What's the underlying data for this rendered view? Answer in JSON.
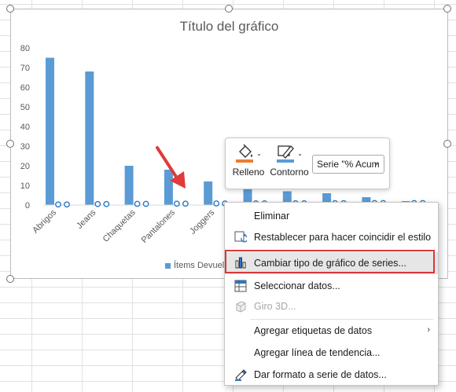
{
  "chart": {
    "title": "Título del gráfico",
    "legend_label": "Ítems Devuelto",
    "y_ticks": [
      "80",
      "70",
      "60",
      "50",
      "40",
      "30",
      "20",
      "10",
      "0"
    ]
  },
  "chart_data": {
    "type": "bar",
    "title": "Título del gráfico",
    "categories": [
      "Abrigos",
      "Jeans",
      "Chaquetas",
      "Pantalones",
      "Joggers",
      "",
      "",
      "",
      "",
      ""
    ],
    "series": [
      {
        "name": "Ítems Devuelto",
        "values": [
          75,
          68,
          20,
          18,
          12,
          8,
          7,
          6,
          4,
          2
        ]
      },
      {
        "name": "% Acum",
        "values": [
          0.3,
          0.5,
          0.6,
          0.7,
          0.8,
          0.85,
          0.9,
          0.95,
          0.98,
          1.0
        ]
      }
    ],
    "ylim": [
      0,
      80
    ],
    "colors": {
      "bar": "#5b9bd5",
      "accent": "#d9383a"
    }
  },
  "minibar": {
    "fill_label": "Relleno",
    "outline_label": "Contorno",
    "series_select": "Serie \"% Acum"
  },
  "context_menu": {
    "items": [
      {
        "label": "Eliminar",
        "icon": "none"
      },
      {
        "label": "Restablecer para hacer coincidir el estilo",
        "icon": "reset-style-icon"
      },
      {
        "label": "Cambiar tipo de gráfico de series...",
        "icon": "change-chart-type-icon"
      },
      {
        "label": "Seleccionar datos...",
        "icon": "select-data-icon"
      },
      {
        "label": "Giro 3D...",
        "icon": "rotate-3d-icon"
      },
      {
        "label": "Agregar etiquetas de datos",
        "icon": "none"
      },
      {
        "label": "Agregar línea de tendencia...",
        "icon": "none"
      },
      {
        "label": "Dar formato a serie de datos...",
        "icon": "format-series-icon"
      }
    ]
  }
}
